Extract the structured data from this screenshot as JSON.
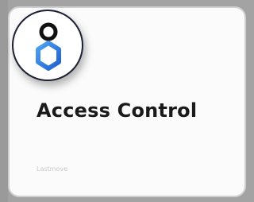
{
  "card": {
    "title": "Access Control",
    "subtitle": "Lastmove",
    "icon": "access-control-icon",
    "colors": {
      "title": "#1a1a1a",
      "icon_dark": "#111111",
      "icon_blue": "#2f7de0"
    }
  }
}
